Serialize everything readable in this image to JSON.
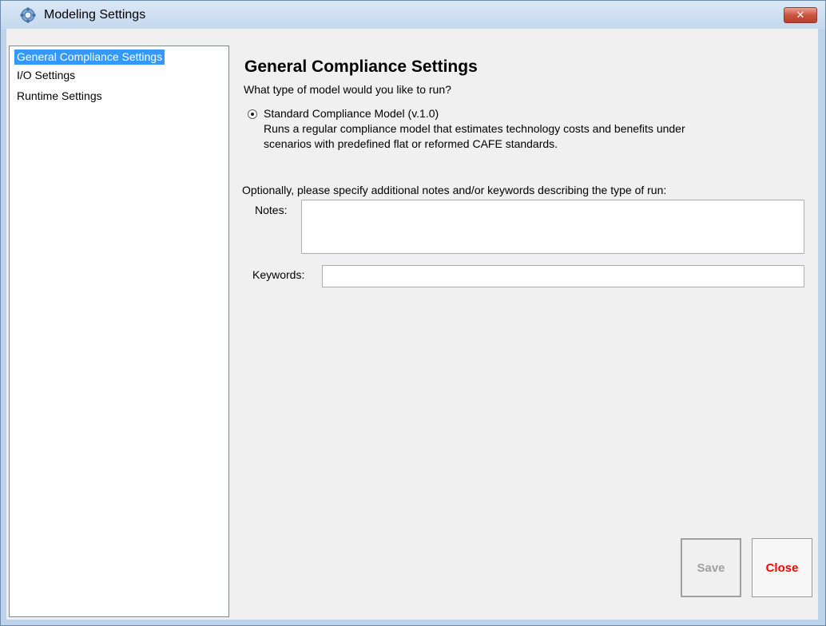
{
  "window": {
    "title": "Modeling Settings",
    "close_glyph": "✕"
  },
  "nav": {
    "items": [
      {
        "label": "General Compliance Settings",
        "selected": true
      },
      {
        "label": "I/O Settings",
        "selected": false
      },
      {
        "label": "Runtime Settings",
        "selected": false
      }
    ]
  },
  "main": {
    "heading": "General Compliance Settings",
    "question": "What type of model would you like to run?",
    "model_option": {
      "label": "Standard Compliance Model (v.1.0)",
      "description_line1": "Runs a regular compliance model that estimates technology costs and benefits under",
      "description_line2": "scenarios with predefined flat or reformed CAFE standards.",
      "selected": true
    },
    "notes_prompt": "Optionally, please specify additional notes and/or keywords describing the type of run:",
    "notes_label": "Notes:",
    "notes_value": "",
    "keywords_label": "Keywords:",
    "keywords_value": ""
  },
  "buttons": {
    "save_label": "Save",
    "close_label": "Close"
  },
  "colors": {
    "selection": "#3399ff",
    "close_text": "#ff0000",
    "disabled_text": "#a0a0a0"
  },
  "icons": {
    "app": "gear-icon",
    "close": "close-icon"
  }
}
